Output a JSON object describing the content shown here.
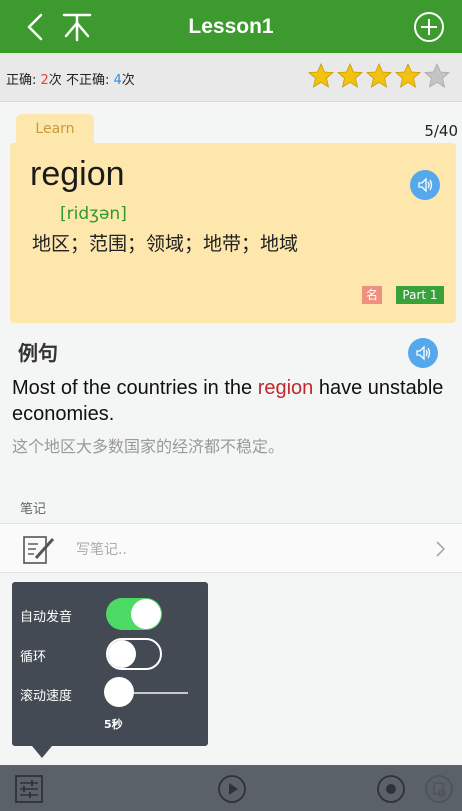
{
  "header": {
    "title": "Lesson1"
  },
  "stats": {
    "correct_label": "正确: ",
    "correct_count": "2",
    "correct_unit": "次 ",
    "incorrect_label": "不正确: ",
    "incorrect_count": "4",
    "incorrect_unit": "次"
  },
  "rating": {
    "filled": 4,
    "total": 5
  },
  "card": {
    "tab": "Learn",
    "counter": "5/40",
    "word": "region",
    "phonetic": "[ridʒən]",
    "meaning": "地区；范围；领域；地带；地域",
    "pos_tag": "名",
    "part_tag": "Part 1"
  },
  "example": {
    "title": "例句",
    "en_before": "Most of the countries in the ",
    "en_highlight": "region",
    "en_after": " have unstable economies.",
    "zh": "这个地区大多数国家的经济都不稳定。"
  },
  "notes": {
    "label": "笔记",
    "placeholder": "写笔记.."
  },
  "popup": {
    "auto_speak_label": "自动发音",
    "auto_speak_on": true,
    "loop_label": "循环",
    "loop_on": false,
    "scroll_speed_label": "滚动速度",
    "scroll_speed_value": "5秒"
  },
  "colors": {
    "header_green": "#3c9a2e",
    "card_yellow": "#fde7ad",
    "highlight_red": "#c0282c",
    "toggle_green": "#4cd964"
  }
}
